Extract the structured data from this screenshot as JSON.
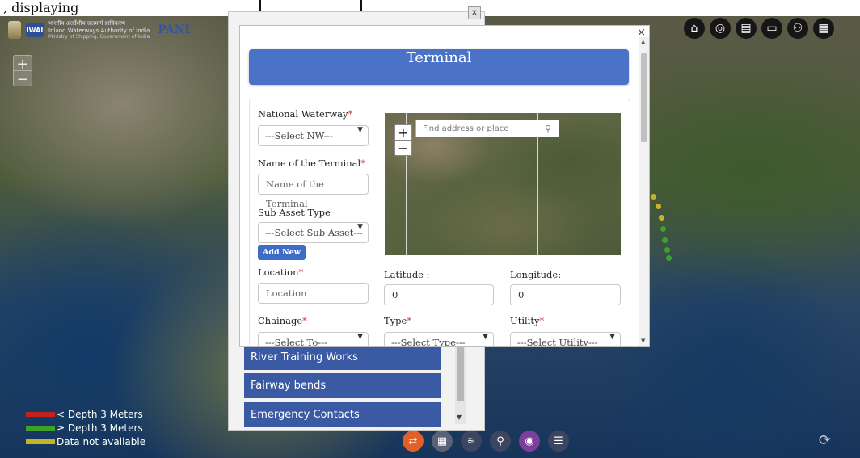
{
  "page": {
    "top_caption": ", displaying"
  },
  "header": {
    "org_line1": "भारतीय अंतर्देशीय जलमार्ग प्राधिकरण",
    "org_line2": "Inland Waterways Authority of India",
    "org_line3": "Ministry of Shipping, Government of India",
    "app_name": "PANI",
    "logo_mark": "IWAI"
  },
  "map_controls": {
    "zoom_in": "+",
    "zoom_out": "−"
  },
  "top_icons": [
    "home-icon",
    "user-icon",
    "presentation-icon",
    "folder-icon",
    "team-icon",
    "grid-icon"
  ],
  "side_panel": {
    "close_label": "x",
    "items": [
      "River Training Works",
      "Fairway bends",
      "Emergency Contacts"
    ]
  },
  "legend": {
    "items": [
      {
        "label": "< Depth 3 Meters",
        "color": "#c0241c"
      },
      {
        "label": "≥ Depth 3 Meters",
        "color": "#3fa12a"
      },
      {
        "label": "Data not available",
        "color": "#c6b32a"
      }
    ]
  },
  "bottom_toolbar": [
    "route-icon",
    "calendar-icon",
    "layers-icon",
    "map-pin-icon",
    "compass-icon",
    "list-icon"
  ],
  "modal": {
    "close_label": "×",
    "title": "Terminal",
    "mini_map": {
      "search_placeholder": "Find address or place",
      "zoom_in": "+",
      "zoom_out": "−"
    },
    "fields": {
      "national_waterway": {
        "label": "National Waterway",
        "value": "---Select NW---"
      },
      "terminal_name": {
        "label": "Name of the Terminal",
        "placeholder": "Name of the Terminal"
      },
      "sub_asset_type": {
        "label": "Sub Asset Type",
        "value": "---Select Sub Asset---"
      },
      "add_new": "Add New",
      "location": {
        "label": "Location",
        "placeholder": "Location"
      },
      "latitude": {
        "label": "Latitude :",
        "value": "0"
      },
      "longitude": {
        "label": "Longitude:",
        "value": "0"
      },
      "chainage": {
        "label": "Chainage",
        "value": "---Select To---"
      },
      "type": {
        "label": "Type",
        "value": "---Select Type---"
      },
      "utility": {
        "label": "Utility",
        "value": "---Select Utility---"
      }
    },
    "required_mark": "*"
  },
  "colors": {
    "accent": "#4a72c6",
    "side_item": "#3a5aa4",
    "required": "#d0312d"
  }
}
